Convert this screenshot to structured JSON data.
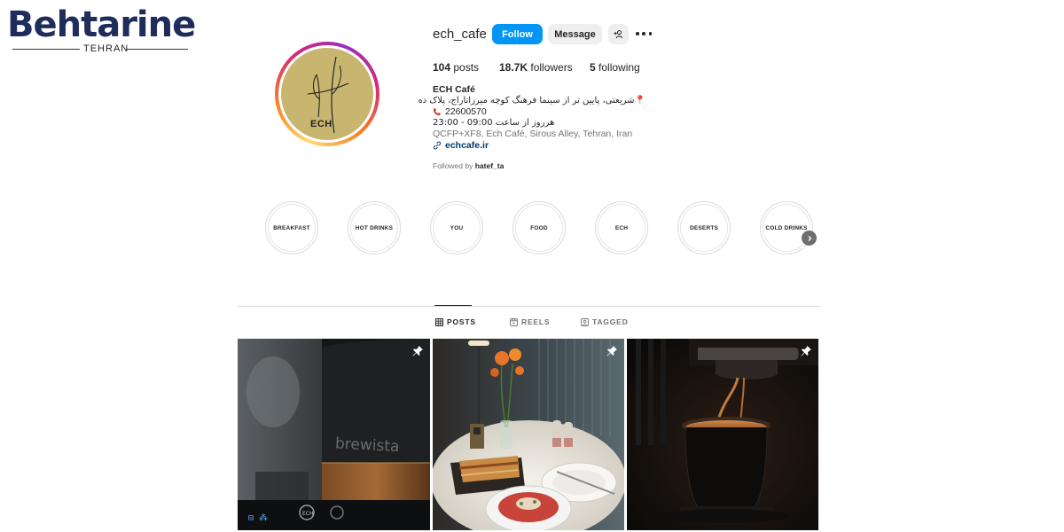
{
  "watermark": {
    "word": "Behtarine",
    "sub": "TEHRAN"
  },
  "profile": {
    "username": "ech_cafe",
    "avatar_text": "ECH",
    "buttons": {
      "follow": "Follow",
      "message": "Message"
    },
    "stats": {
      "posts": {
        "count": "104",
        "label": "posts"
      },
      "followers": {
        "count": "18.7K",
        "label": "followers"
      },
      "following": {
        "count": "5",
        "label": "following"
      }
    },
    "bio": {
      "name": "ECH Café",
      "address_fa": "شریعتی، پایین تر از سینما فرهنگ کوچه میرزاتاراج، پلاک ده",
      "phone": "22600570",
      "hours_fa": "هرروز از ساعت 09:00 - 23:00",
      "address_en": "QCFP+XF8, Ech Café, Sirous Alley, Tehran, Iran",
      "link": "echcafe.ir"
    },
    "followed_by": {
      "prefix": "Followed by",
      "user": "hatef_ta"
    }
  },
  "highlights": [
    "BREAKFAST",
    "HOT DRINKS",
    "YOU",
    "FOOD",
    "ECH",
    "DESERTS",
    "COLD DRINKS"
  ],
  "tabs": [
    {
      "label": "POSTS",
      "icon": "grid-icon",
      "active": true
    },
    {
      "label": "REELS",
      "icon": "reels-icon",
      "active": false
    },
    {
      "label": "TAGGED",
      "icon": "tagged-icon",
      "active": false
    }
  ],
  "posts": [
    {
      "subject": "brewista kettle",
      "pinned": true,
      "brand_text": "brewista"
    },
    {
      "subject": "table with flowers, lasagna and salad",
      "pinned": true
    },
    {
      "subject": "espresso pouring",
      "pinned": true
    }
  ],
  "colors": {
    "accent": "#0095f6",
    "link": "#00376b",
    "muted": "#737373"
  }
}
